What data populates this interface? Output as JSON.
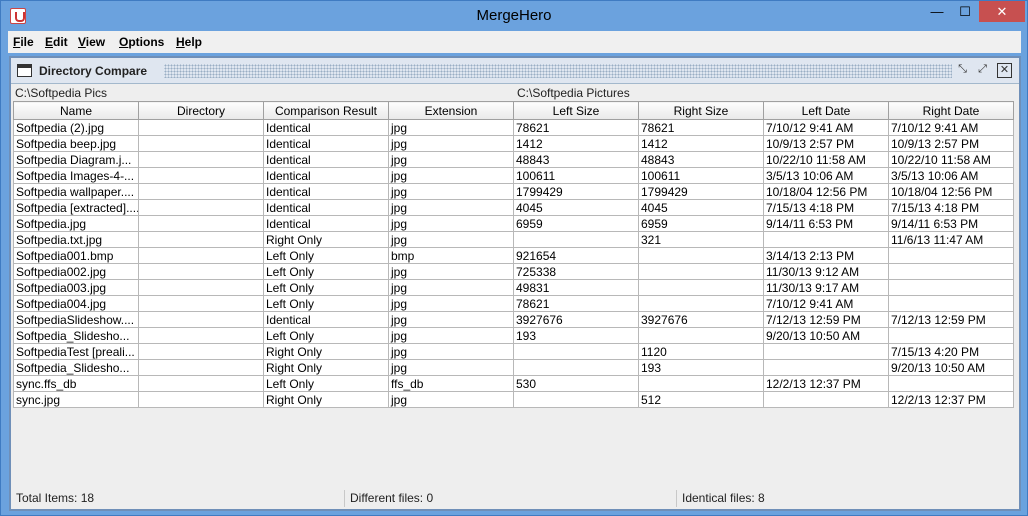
{
  "window": {
    "title": "MergeHero",
    "minimize": "—",
    "maximize": "☐",
    "close": "✕"
  },
  "menu": [
    {
      "key": "F",
      "rest": "ile"
    },
    {
      "key": "E",
      "rest": "dit"
    },
    {
      "key": "V",
      "rest": "iew"
    },
    {
      "key": "O",
      "rest": "ptions"
    },
    {
      "key": "H",
      "rest": "elp"
    }
  ],
  "frame": {
    "title": "Directory Compare",
    "iconify": "⤡",
    "maximize": "⤢",
    "close": "✕"
  },
  "paths": {
    "left": "C:\\Softpedia Pics",
    "right": "C:\\Softpedia Pictures"
  },
  "columns": [
    "Name",
    "Directory",
    "Comparison Result",
    "Extension",
    "Left Size",
    "Right Size",
    "Left Date",
    "Right Date"
  ],
  "rows": [
    [
      "Softpedia (2).jpg",
      "",
      "Identical",
      "jpg",
      "78621",
      "78621",
      "7/10/12 9:41 AM",
      "7/10/12 9:41 AM"
    ],
    [
      "Softpedia beep.jpg",
      "",
      "Identical",
      "jpg",
      "1412",
      "1412",
      "10/9/13 2:57 PM",
      "10/9/13 2:57 PM"
    ],
    [
      "Softpedia Diagram.j...",
      "",
      "Identical",
      "jpg",
      "48843",
      "48843",
      "10/22/10 11:58 AM",
      "10/22/10 11:58 AM"
    ],
    [
      "Softpedia Images-4-...",
      "",
      "Identical",
      "jpg",
      "100611",
      "100611",
      "3/5/13 10:06 AM",
      "3/5/13 10:06 AM"
    ],
    [
      "Softpedia wallpaper....",
      "",
      "Identical",
      "jpg",
      "1799429",
      "1799429",
      "10/18/04 12:56 PM",
      "10/18/04 12:56 PM"
    ],
    [
      "Softpedia [extracted]....",
      "",
      "Identical",
      "jpg",
      "4045",
      "4045",
      "7/15/13 4:18 PM",
      "7/15/13 4:18 PM"
    ],
    [
      "Softpedia.jpg",
      "",
      "Identical",
      "jpg",
      "6959",
      "6959",
      "9/14/11 6:53 PM",
      "9/14/11 6:53 PM"
    ],
    [
      "Softpedia.txt.jpg",
      "",
      "Right Only",
      "jpg",
      "",
      "321",
      "",
      "11/6/13 11:47 AM"
    ],
    [
      "Softpedia001.bmp",
      "",
      "Left Only",
      "bmp",
      "921654",
      "",
      "3/14/13 2:13 PM",
      ""
    ],
    [
      "Softpedia002.jpg",
      "",
      "Left Only",
      "jpg",
      "725338",
      "",
      "11/30/13 9:12 AM",
      ""
    ],
    [
      "Softpedia003.jpg",
      "",
      "Left Only",
      "jpg",
      "49831",
      "",
      "11/30/13 9:17 AM",
      ""
    ],
    [
      "Softpedia004.jpg",
      "",
      "Left Only",
      "jpg",
      "78621",
      "",
      "7/10/12 9:41 AM",
      ""
    ],
    [
      "SoftpediaSlideshow....",
      "",
      "Identical",
      "jpg",
      "3927676",
      "3927676",
      "7/12/13 12:59 PM",
      "7/12/13 12:59 PM"
    ],
    [
      "Softpedia_Slidesho...",
      "",
      "Left Only",
      "jpg",
      "193",
      "",
      "9/20/13 10:50 AM",
      ""
    ],
    [
      "SoftpediaTest [preali...",
      "",
      "Right Only",
      "jpg",
      "",
      "1120",
      "",
      "7/15/13 4:20 PM"
    ],
    [
      "Softpedia_Slidesho...",
      "",
      "Right Only",
      "jpg",
      "",
      "193",
      "",
      "9/20/13 10:50 AM"
    ],
    [
      "sync.ffs_db",
      "",
      "Left Only",
      "ffs_db",
      "530",
      "",
      "12/2/13 12:37 PM",
      ""
    ],
    [
      "sync.jpg",
      "",
      "Right Only",
      "jpg",
      "",
      "512",
      "",
      "12/2/13 12:37 PM"
    ]
  ],
  "status": {
    "total": "Total Items: 18",
    "different": "Different files: 0",
    "identical": "Identical files: 8"
  }
}
